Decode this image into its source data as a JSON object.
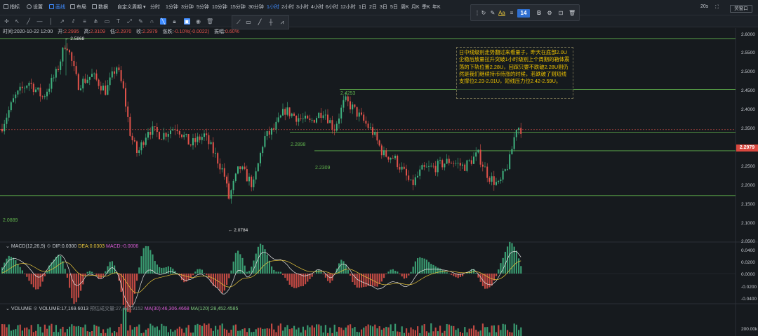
{
  "toolbar": {
    "indicators": "指标",
    "settings": "设置",
    "drawing": "画线",
    "layout": "布局",
    "data": "数据",
    "custom_period": "自定义周期",
    "periods": [
      "分时",
      "1分钟",
      "3分钟",
      "5分钟",
      "10分钟",
      "15分钟",
      "30分钟",
      "1小时",
      "2小时",
      "3小时",
      "4小时",
      "6小时",
      "12小时",
      "1日",
      "2日",
      "3日",
      "5日",
      "周K",
      "月K",
      "季K",
      "年K"
    ],
    "active_period": "1小时",
    "interval_right": "20s",
    "mode_button": "荧窗口"
  },
  "text_toolbar": {
    "font_size": "14"
  },
  "info": {
    "time_label": "时间:",
    "time_value": "2020-10-22 12:00",
    "open_label": "开:",
    "open_value": "2.2995",
    "high_label": "高:",
    "high_value": "2.3109",
    "low_label": "低:",
    "low_value": "2.2970",
    "close_label": "收:",
    "close_value": "2.2979",
    "change_label": "涨跌:",
    "change_value": "-0.10%(-0.0022)",
    "amp_label": "振幅:",
    "amp_value": "0.60%"
  },
  "main_chart": {
    "price_axis": [
      "2.6000",
      "2.5500",
      "2.5000",
      "2.4500",
      "2.4000",
      "2.3500",
      "2.3000",
      "2.2500",
      "2.2000",
      "2.1500",
      "2.1000",
      "2.0500"
    ],
    "current_price": "2.2979",
    "high_marker": "← 2.5868",
    "low_marker": "← 2.0784",
    "levels": {
      "top_label": "2.4253",
      "mid_label": "2.2898",
      "lower_label": "2.2309",
      "bottom_label": "2.0889"
    },
    "note": "日中线级别走势翻过来看量子，昨天在底部2.0U企稳后放量拉升突破1小时级别上个周期的箱体震荡的下轨位置2.28U，回踩只要不跌破2.28U则仍然是我们继续持币待涨的时候，若跌破了则短线支撑位2.23-2.01U，短线压力位2.42-2.59U。"
  },
  "macd": {
    "title": "MACD(12,26,9)",
    "dif_label": "DIF:",
    "dif_value": "0.0300",
    "dea_label": "DEA:",
    "dea_value": "0.0303",
    "macd_label": "MACD:",
    "macd_value": "-0.0006",
    "axis": [
      "0.0400",
      "0.0200",
      "0.0000",
      "-0.0200",
      "-0.0400"
    ]
  },
  "volume": {
    "title": "VOLUME",
    "vol_label": "VOLUME:",
    "vol_value": "17,169.6013",
    "est_label": "预估成交量:",
    "est_value": "27,993.9152",
    "ma30_label": "MA(30):",
    "ma30_value": "46,306.4668",
    "ma120_label": "MA(120):",
    "ma120_value": "28,452.4585",
    "axis": [
      "200.00k"
    ]
  },
  "colors": {
    "up": "#3fb27f",
    "down": "#e0524a",
    "level_line": "#5fb04c",
    "note_text": "#f0c400",
    "active": "#3f8cff"
  }
}
